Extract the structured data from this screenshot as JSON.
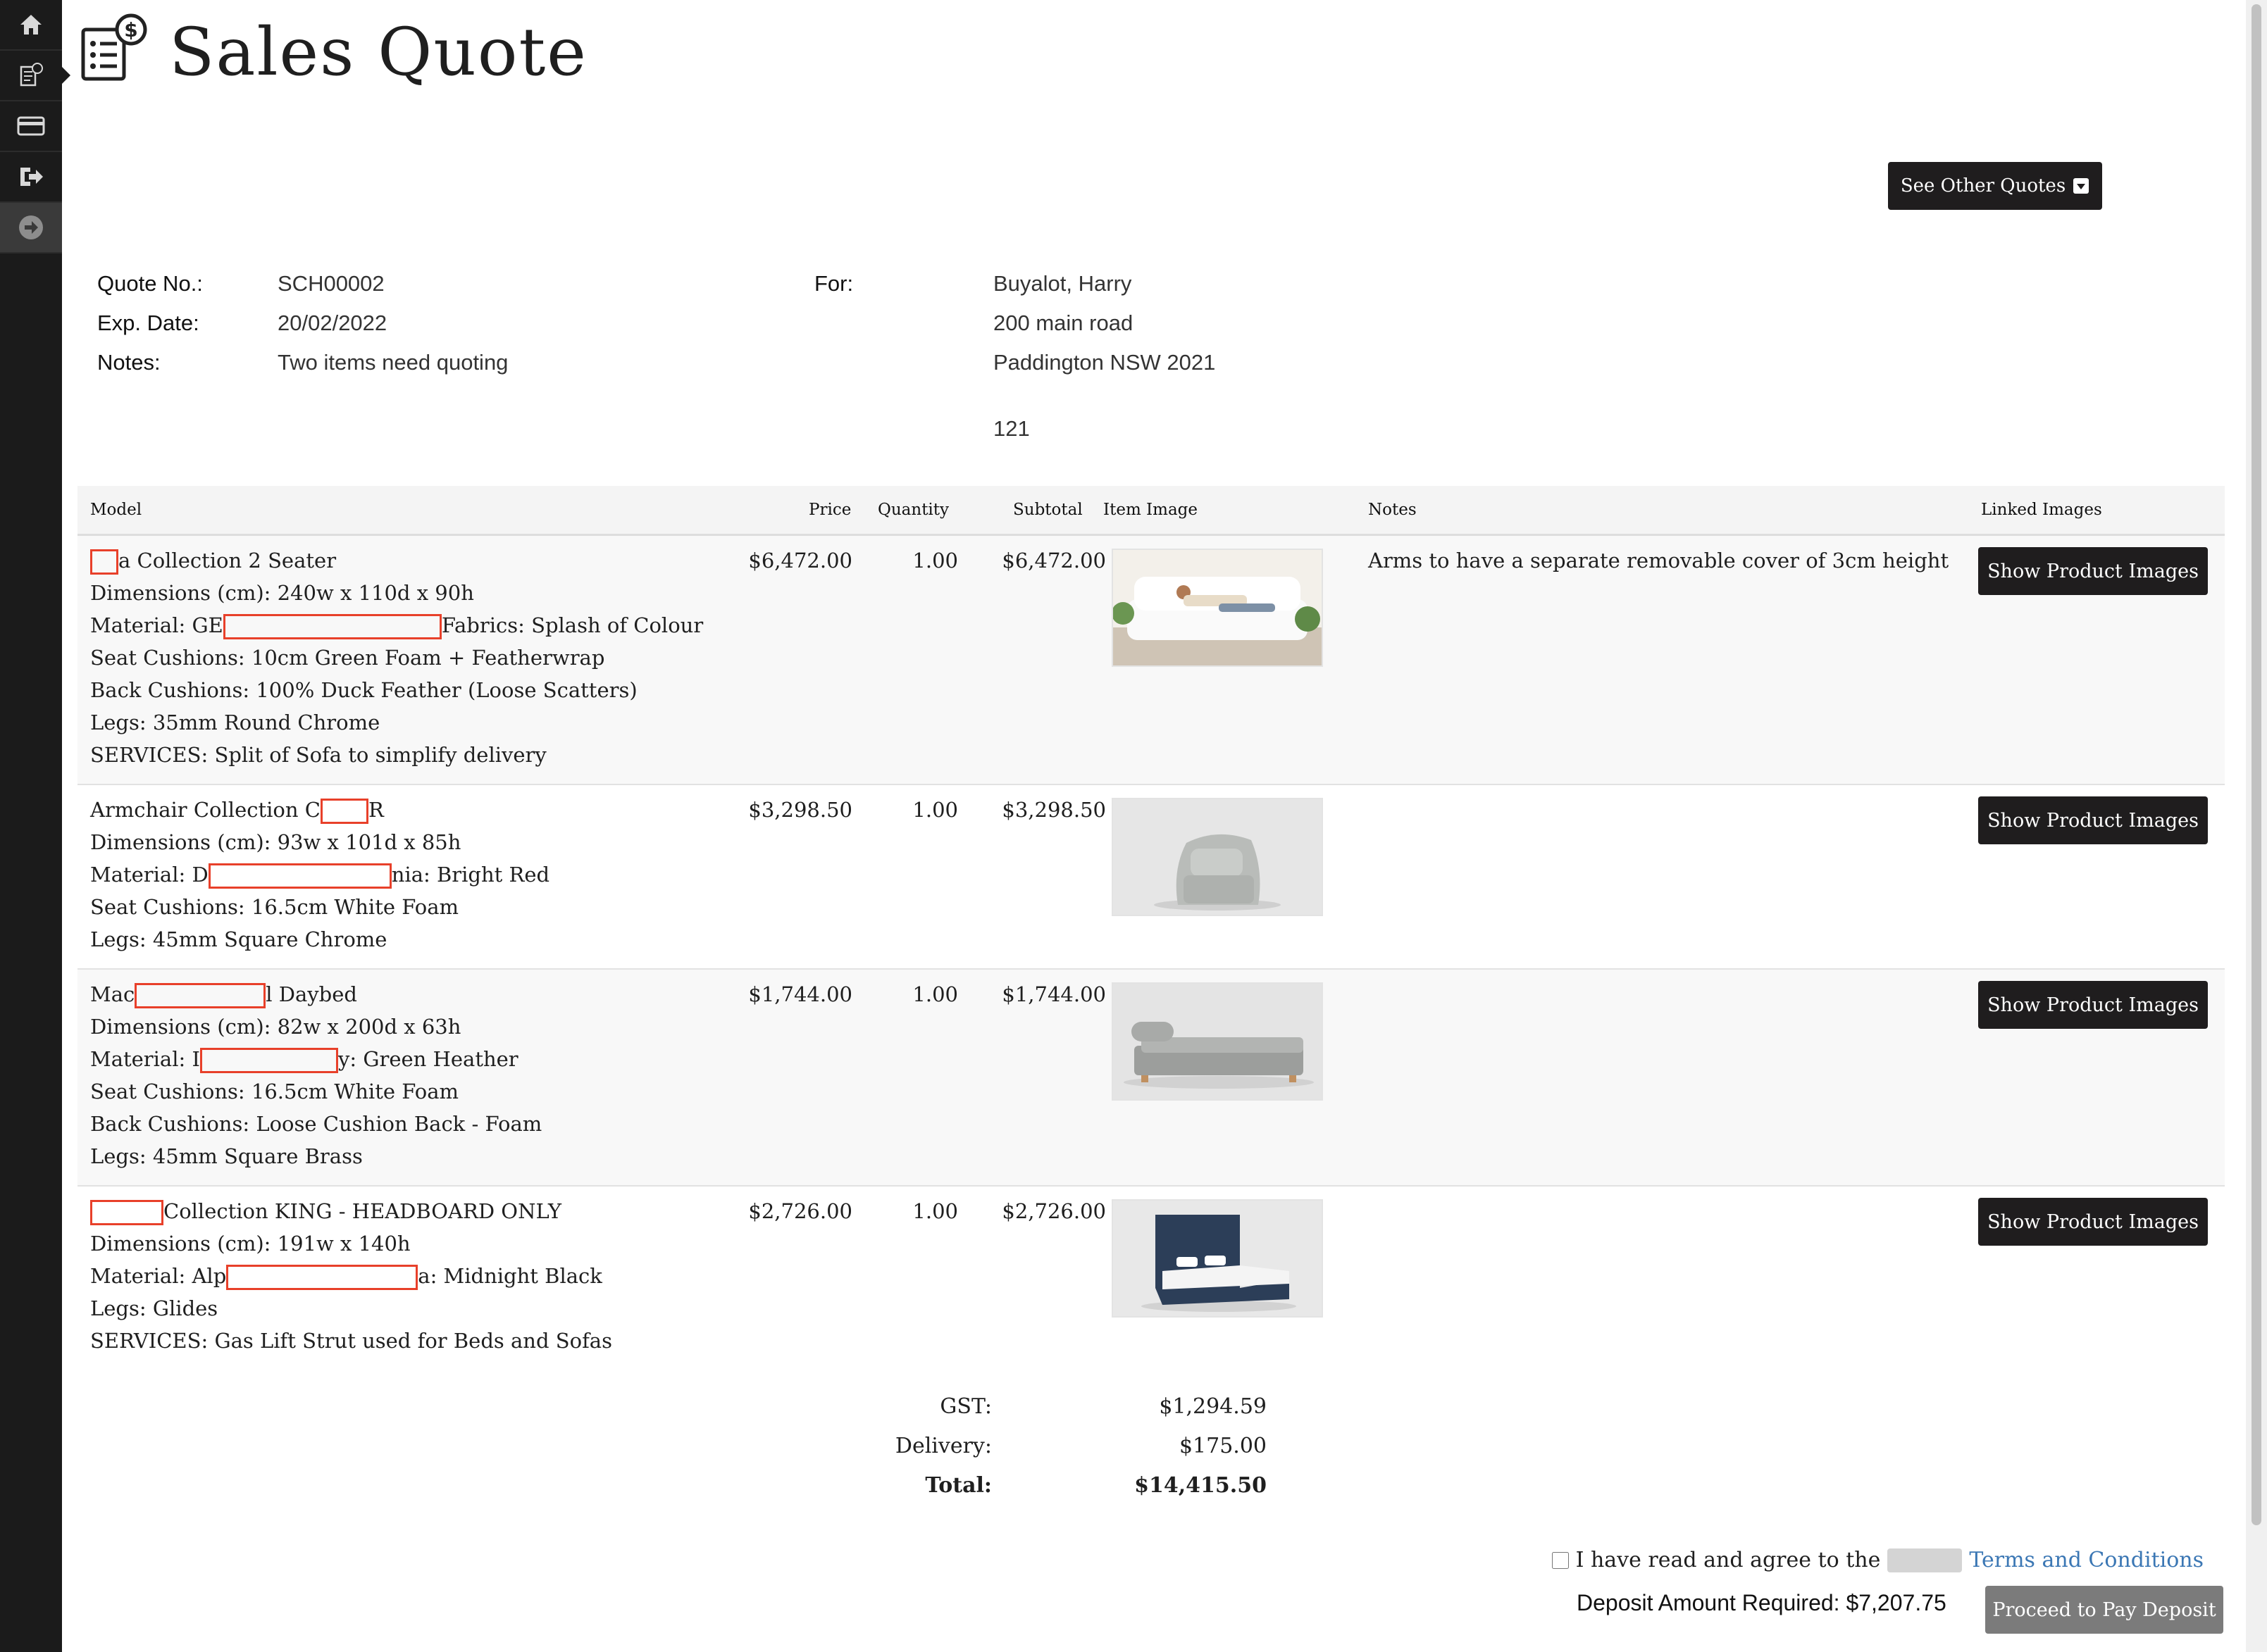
{
  "page": {
    "title": "Sales Quote"
  },
  "header": {
    "other_quotes_label": "See Other Quotes"
  },
  "quote": {
    "number_label": "Quote No.:",
    "number": "SCH00002",
    "exp_label": "Exp. Date:",
    "exp": "20/02/2022",
    "notes_label": "Notes:",
    "notes": "Two items need quoting",
    "for_label": "For:",
    "customer": "Buyalot, Harry",
    "address1": "200 main road",
    "address2": "Paddington NSW 2021",
    "extra": "121"
  },
  "table": {
    "headers": {
      "model": "Model",
      "price": "Price",
      "quantity": "Quantity",
      "subtotal": "Subtotal",
      "item_image": "Item Image",
      "notes": "Notes",
      "linked": "Linked Images"
    },
    "show_images_label": "Show Product Images",
    "rows": [
      {
        "line1_a": "",
        "line1_b": "a Collection 2 Seater",
        "dims": "Dimensions (cm): 240w x 110d x 90h",
        "mat_a": "Material: GE",
        "mat_b": "Fabrics: Splash of Colour",
        "l4": "Seat Cushions: 10cm Green Foam + Featherwrap",
        "l5": "Back Cushions: 100% Duck Feather (Loose Scatters)",
        "l6": "Legs: 35mm Round Chrome",
        "l7": "SERVICES: Split of Sofa to simplify delivery",
        "price": "$6,472.00",
        "qty": "1.00",
        "subtotal": "$6,472.00",
        "note": "Arms to have a separate removable cover of 3cm height"
      },
      {
        "line1_a": "Armchair Collection C",
        "line1_b": "R",
        "dims": "Dimensions (cm): 93w x 101d x 85h",
        "mat_a": "Material: D",
        "mat_b": "nia: Bright Red",
        "l4": "Seat Cushions: 16.5cm White Foam",
        "l5": "Legs: 45mm Square Chrome",
        "price": "$3,298.50",
        "qty": "1.00",
        "subtotal": "$3,298.50"
      },
      {
        "line1_a": "Mac",
        "line1_b": "l Daybed",
        "dims": "Dimensions (cm): 82w x 200d x 63h",
        "mat_a": "Material: I",
        "mat_b": "y: Green Heather",
        "l4": "Seat Cushions: 16.5cm White Foam",
        "l5": "Back Cushions: Loose Cushion Back - Foam",
        "l6": "Legs: 45mm Square Brass",
        "price": "$1,744.00",
        "qty": "1.00",
        "subtotal": "$1,744.00"
      },
      {
        "line1_a": "",
        "line1_b": "Collection KING - HEADBOARD ONLY",
        "dims": "Dimensions (cm): 191w x 140h",
        "mat_a": "Material: Alp",
        "mat_b": "a: Midnight Black",
        "l4": "Legs: Glides",
        "l5": "SERVICES: Gas Lift Strut used for Beds and Sofas",
        "price": "$2,726.00",
        "qty": "1.00",
        "subtotal": "$2,726.00"
      }
    ]
  },
  "totals": {
    "gst_label": "GST:",
    "gst": "$1,294.59",
    "delivery_label": "Delivery:",
    "delivery": "$175.00",
    "total_label": "Total:",
    "total": "$14,415.50"
  },
  "footer": {
    "agree_text": "I have read and agree to the",
    "terms_link": "Terms and Conditions",
    "deposit_text": "Deposit Amount Required: $7,207.75",
    "pay_label": "Proceed to Pay Deposit"
  },
  "colors": {
    "accent_dark": "#1f1d1e",
    "link": "#3b77b4",
    "redaction": "#e8402a",
    "disabled_btn": "#7b7b7b"
  }
}
